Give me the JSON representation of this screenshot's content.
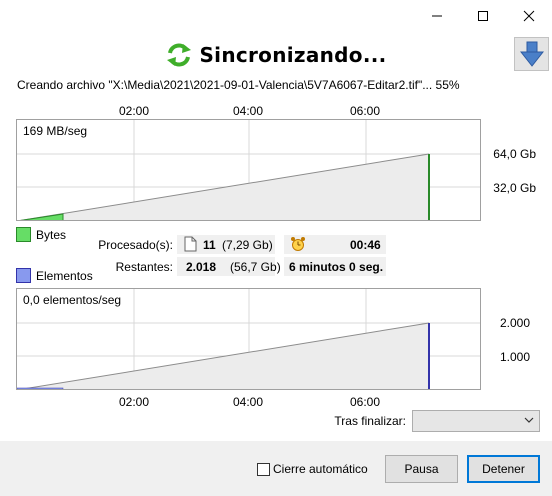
{
  "window": {
    "title_buttons": {
      "minimize_icon": "minimize-icon",
      "maximize_icon": "maximize-icon",
      "close_icon": "close-icon"
    }
  },
  "header": {
    "title": "Sincronizando...",
    "icon": "sync-arrows-icon"
  },
  "status": {
    "text": "Creando archivo \"X:\\Media\\2021\\2021-09-01-Valencia\\5V7A6067-Editar2.tif\"... 55%"
  },
  "time_axis": {
    "ticks": [
      "02:00",
      "04:00",
      "06:00"
    ]
  },
  "bytes_chart": {
    "rate": "169 MB/seg",
    "y_labels": [
      "64,0 Gb",
      "32,0 Gb"
    ],
    "legend": "Bytes",
    "color": "#66dd66",
    "projection_color": "#2a8a2a"
  },
  "processing": {
    "processed_label": "Procesado(s):",
    "remaining_label": "Restantes:",
    "processed_count": "11",
    "processed_size": "(7,29 Gb)",
    "remaining_count": "2.018",
    "remaining_size": "(56,7 Gb)",
    "elapsed": "00:46",
    "remaining_time": "6 minutos 0 seg."
  },
  "elements_chart": {
    "rate": "0,0 elementos/seg",
    "y_labels": [
      "2.000",
      "1.000"
    ],
    "legend": "Elementos",
    "color": "#8899ee",
    "projection_color": "#3333aa"
  },
  "after": {
    "label": "Tras finalizar:",
    "value": ""
  },
  "footer": {
    "auto_close_label": "Cierre automático",
    "auto_close_checked": false,
    "pause_label": "Pausa",
    "stop_label": "Detener"
  }
}
